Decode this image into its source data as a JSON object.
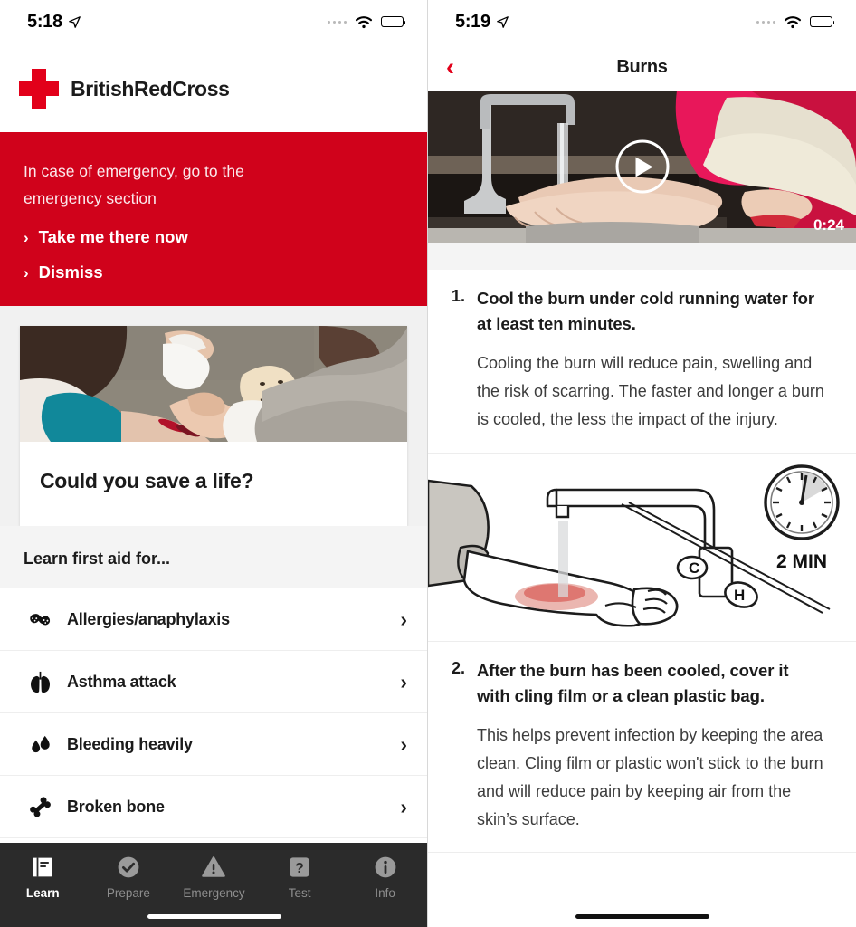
{
  "left": {
    "status": {
      "time": "5:18",
      "location_icon": "location-arrow-icon",
      "wifi_icon": "wifi-icon",
      "battery_icon": "battery-icon",
      "cellular_icon": "cellular-dots-icon"
    },
    "brand": {
      "logo_icon": "red-cross-logo-icon",
      "name": "BritishRedCross",
      "accent": "#e2001a"
    },
    "emergency_banner": {
      "background": "#d0021b",
      "message": "In case of emergency, go to the emergency section",
      "primary_link": "Take me there now",
      "secondary_link": "Dismiss",
      "chevron": "›"
    },
    "promo_card": {
      "image_alt": "first-aid-training-cpr-manikin",
      "title": "Could you save a life?"
    },
    "section": {
      "heading": "Learn first aid for..."
    },
    "topics": [
      {
        "label": "Allergies/anaphylaxis",
        "icon": "peanut-icon",
        "chevron": "›"
      },
      {
        "label": "Asthma attack",
        "icon": "lungs-icon",
        "chevron": "›"
      },
      {
        "label": "Bleeding heavily",
        "icon": "blood-drops-icon",
        "chevron": "›"
      },
      {
        "label": "Broken bone",
        "icon": "bone-icon",
        "chevron": "›"
      }
    ],
    "tabs": [
      {
        "label": "Learn",
        "icon": "book-icon",
        "active": true
      },
      {
        "label": "Prepare",
        "icon": "check-circle-icon",
        "active": false
      },
      {
        "label": "Emergency",
        "icon": "warning-triangle-icon",
        "active": false
      },
      {
        "label": "Test",
        "icon": "question-mark-icon",
        "active": false
      },
      {
        "label": "Info",
        "icon": "info-circle-icon",
        "active": false
      }
    ]
  },
  "right": {
    "status": {
      "time": "5:19",
      "location_icon": "location-arrow-icon",
      "wifi_icon": "wifi-icon",
      "battery_icon": "battery-icon",
      "cellular_icon": "cellular-dots-icon"
    },
    "navbar": {
      "back_icon": "chevron-left-icon",
      "back_glyph": "‹",
      "title": "Burns"
    },
    "video": {
      "play_icon": "play-button-icon",
      "duration": "0:24",
      "image_alt": "hand-under-running-tap-water"
    },
    "steps": [
      {
        "number": "1.",
        "title": "Cool the burn under cold running water for at least ten minutes.",
        "body": "Cooling the burn will reduce pain, swelling and the risk of scarring. The faster and longer a burn is cooled, the less the impact of the injury."
      },
      {
        "number": "2.",
        "title": "After the burn has been cooled, cover it with cling film or a clean plastic bag.",
        "body": "This helps prevent infection by keeping the area clean. Cling film or plastic won't stick to the burn and will reduce pain by keeping air from the skin’s surface."
      }
    ],
    "illustration": {
      "alt": "arm-under-tap-illustration",
      "clock_label": "2 MIN",
      "cold_tap_label": "C",
      "hot_tap_label": "H"
    }
  }
}
